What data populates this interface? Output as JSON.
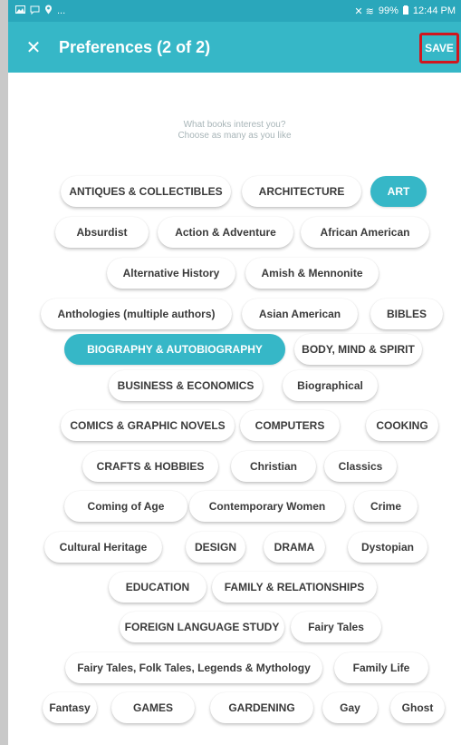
{
  "status_bar": {
    "left_icons": [
      "image-icon",
      "chat-icon",
      "location-icon"
    ],
    "left_more": "...",
    "signal_glyphs": "✕ ≋",
    "battery": "99%",
    "time": "12:44 PM"
  },
  "app_bar": {
    "close_glyph": "✕",
    "title": "Preferences (2 of 2)",
    "save_label": "SAVE"
  },
  "prompt": {
    "line1": "What books interest you?",
    "line2": "Choose as many as you like"
  },
  "chips": [
    {
      "label": "ANTIQUES & COLLECTIBLES",
      "selected": false
    },
    {
      "label": "ARCHITECTURE",
      "selected": false
    },
    {
      "label": "ART",
      "selected": true
    },
    {
      "label": "Absurdist",
      "selected": false
    },
    {
      "label": "Action & Adventure",
      "selected": false
    },
    {
      "label": "African American",
      "selected": false
    },
    {
      "label": "Alternative History",
      "selected": false
    },
    {
      "label": "Amish & Mennonite",
      "selected": false
    },
    {
      "label": "Anthologies (multiple authors)",
      "selected": false
    },
    {
      "label": "Asian American",
      "selected": false
    },
    {
      "label": "BIBLES",
      "selected": false
    },
    {
      "label": "BIOGRAPHY & AUTOBIOGRAPHY",
      "selected": true
    },
    {
      "label": "BODY, MIND & SPIRIT",
      "selected": false
    },
    {
      "label": "BUSINESS & ECONOMICS",
      "selected": false
    },
    {
      "label": "Biographical",
      "selected": false
    },
    {
      "label": "COMICS & GRAPHIC NOVELS",
      "selected": false
    },
    {
      "label": "COMPUTERS",
      "selected": false
    },
    {
      "label": "COOKING",
      "selected": false
    },
    {
      "label": "CRAFTS & HOBBIES",
      "selected": false
    },
    {
      "label": "Christian",
      "selected": false
    },
    {
      "label": "Classics",
      "selected": false
    },
    {
      "label": "Coming of Age",
      "selected": false
    },
    {
      "label": "Contemporary Women",
      "selected": false
    },
    {
      "label": "Crime",
      "selected": false
    },
    {
      "label": "Cultural Heritage",
      "selected": false
    },
    {
      "label": "DESIGN",
      "selected": false
    },
    {
      "label": "DRAMA",
      "selected": false
    },
    {
      "label": "Dystopian",
      "selected": false
    },
    {
      "label": "EDUCATION",
      "selected": false
    },
    {
      "label": "FAMILY & RELATIONSHIPS",
      "selected": false
    },
    {
      "label": "FOREIGN LANGUAGE STUDY",
      "selected": false
    },
    {
      "label": "Fairy Tales",
      "selected": false
    },
    {
      "label": "Fairy Tales, Folk Tales, Legends & Mythology",
      "selected": false
    },
    {
      "label": "Family Life",
      "selected": false
    },
    {
      "label": "Fantasy",
      "selected": false
    },
    {
      "label": "GAMES",
      "selected": false
    },
    {
      "label": "GARDENING",
      "selected": false
    },
    {
      "label": "Gay",
      "selected": false
    },
    {
      "label": "Ghost",
      "selected": false
    }
  ],
  "colors": {
    "accent": "#36b7c7",
    "status_bar": "#2aa7bb",
    "highlight_border": "#d0161e",
    "chip_text": "#3a3a3a",
    "prompt_text": "#a8b5b8"
  }
}
